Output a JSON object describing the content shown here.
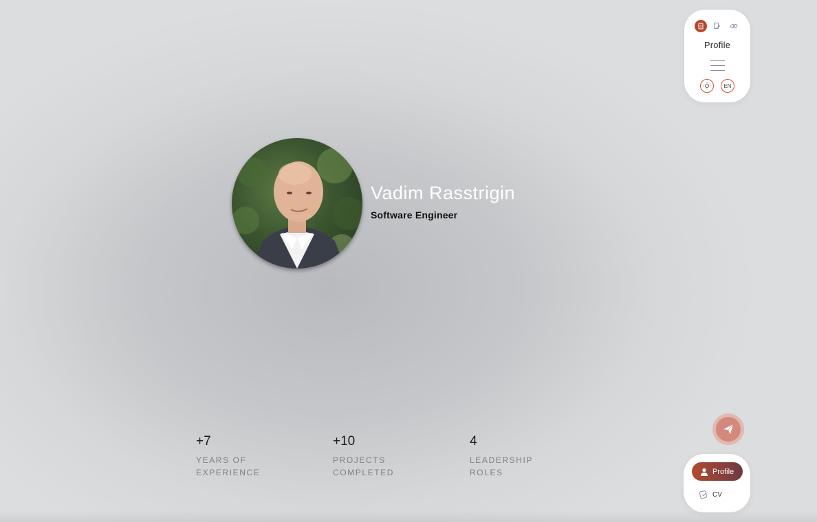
{
  "menu": {
    "title": "Profile",
    "tabs": [
      {
        "icon": "document-icon",
        "active": true
      },
      {
        "icon": "edit-icon",
        "active": false
      },
      {
        "icon": "link-icon",
        "active": false
      }
    ],
    "theme_icon": "sun-icon",
    "language": "EN"
  },
  "profile": {
    "name": "Vadim Rasstrigin",
    "role": "Software Engineer",
    "avatar_alt": "portrait"
  },
  "stats": [
    {
      "value": "+7",
      "label_line1": "YEARS OF",
      "label_line2": "EXPERIENCE"
    },
    {
      "value": "+10",
      "label_line1": "PROJECTS",
      "label_line2": "COMPLETED"
    },
    {
      "value": "4",
      "label_line1": "LEADERSHIP",
      "label_line2": "ROLES"
    }
  ],
  "bottom_nav": {
    "profile_label": "Profile",
    "cv_label": "CV"
  },
  "colors": {
    "accent": "#b5472f",
    "accent_dark": "#6e3a44",
    "ring": "#d0523d",
    "send_bg": "#d3897b"
  }
}
